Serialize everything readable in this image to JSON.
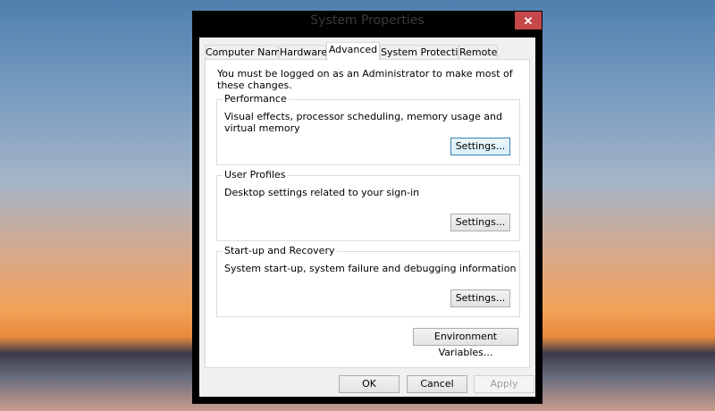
{
  "window": {
    "title": "System Properties",
    "close_icon": "close-icon"
  },
  "tabs": [
    {
      "label": "Computer Name"
    },
    {
      "label": "Hardware"
    },
    {
      "label": "Advanced",
      "active": true
    },
    {
      "label": "System Protection"
    },
    {
      "label": "Remote"
    }
  ],
  "admin_notice": "You must be logged on as an Administrator to make most of these changes.",
  "groups": [
    {
      "label": "Performance",
      "description": "Visual effects, processor scheduling, memory usage and virtual memory",
      "button": "Settings..."
    },
    {
      "label": "User Profiles",
      "description": "Desktop settings related to your sign-in",
      "button": "Settings..."
    },
    {
      "label": "Start-up and Recovery",
      "description": "System start-up, system failure and debugging information",
      "button": "Settings..."
    }
  ],
  "env_button": "Environment Variables...",
  "footer": {
    "ok": "OK",
    "cancel": "Cancel",
    "apply": "Apply"
  }
}
